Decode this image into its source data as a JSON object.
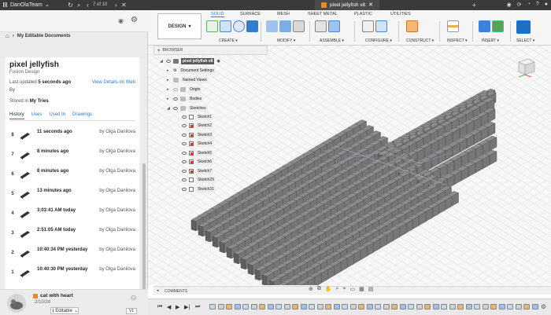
{
  "topbar": {
    "team": "DanOlaTeam",
    "counter": "7 of 10",
    "doc_tab": "pixel jellyfish v8"
  },
  "left_panel": {
    "breadcrumb": "My Editable Documents",
    "doc_title": "pixel jellyfish",
    "doc_sub": "Fusion Design",
    "updated_prefix": "Last updated ",
    "updated_value": "5 seconds ago",
    "by_label": "By",
    "view_link": "View Details on Web",
    "stored_prefix": "Stored in ",
    "stored_value": "My Tries",
    "tabs": [
      "History",
      "Uses",
      "Used In",
      "Drawings"
    ],
    "versions": [
      {
        "num": "8",
        "when": "11 seconds ago",
        "who": "by Olga Danilova"
      },
      {
        "num": "7",
        "when": "8 minutes ago",
        "who": "by Olga Danilova"
      },
      {
        "num": "6",
        "when": "8 minutes ago",
        "who": "by Olga Danilova"
      },
      {
        "num": "5",
        "when": "13 minutes ago",
        "who": "by Olga Danilova"
      },
      {
        "num": "4",
        "when": "3:03:41 AM today",
        "who": "by Olga Danilova"
      },
      {
        "num": "3",
        "when": "2:51:05 AM today",
        "who": "by Olga Danilova"
      },
      {
        "num": "2",
        "when": "10:40:34 PM yesterday",
        "who": "by Olga Danilova"
      },
      {
        "num": "1",
        "when": "10:40:30 PM yesterday",
        "who": "by Olga Danilova"
      }
    ],
    "bottom_item": {
      "name": "cat with heart",
      "date": "2/10/24",
      "status": "Editable",
      "version": "V1"
    }
  },
  "toolbar": {
    "design_label": "DESIGN",
    "workspace_tabs": [
      "SOLID",
      "SURFACE",
      "MESH",
      "SHEET METAL",
      "PLASTIC",
      "UTILITIES"
    ],
    "active_tab": "SOLID",
    "groups": [
      "CREATE",
      "MODIFY",
      "ASSEMBLE",
      "CONFIGURE",
      "CONSTRUCT",
      "INSPECT",
      "INSERT",
      "SELECT"
    ]
  },
  "browser": {
    "header": "BROWSER",
    "root": "pixel jellyfish v8",
    "items": [
      "Document Settings",
      "Named Views",
      "Origin",
      "Bodies",
      "Sketches"
    ],
    "sketches": [
      "Sketch1",
      "Sketch2",
      "Sketch3",
      "Sketch4",
      "Sketch5",
      "Sketch6",
      "Sketch7",
      "Sketch29",
      "Sketch31"
    ]
  },
  "comments": {
    "label": "COMMENTS"
  },
  "colors": {
    "accent": "#2b7bd6",
    "topbar": "#3a3a3a",
    "block_top": "#8c8c8c",
    "block_side": "#5f5f5f"
  }
}
